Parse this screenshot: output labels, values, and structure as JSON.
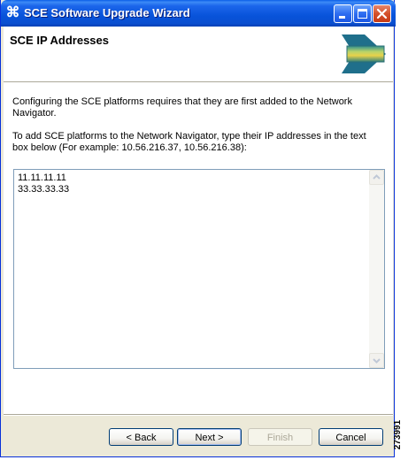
{
  "window": {
    "title": "SCE Software Upgrade Wizard",
    "app_icon": "cisco-bridge-icon"
  },
  "header": {
    "title": "SCE IP Addresses",
    "logo_icon": "wizard-banner-icon"
  },
  "content": {
    "paragraph1": "Configuring the SCE platforms requires that they are first added to the Network Navigator.",
    "paragraph2": "To add SCE platforms to the Network Navigator, type their IP addresses in the text box below (For example: 10.56.216.37, 10.56.216.38):",
    "ip_lines": [
      "11.11.11.11",
      "33.33.33.33"
    ]
  },
  "buttons": {
    "back": "< Back",
    "next": "Next >",
    "finish": "Finish",
    "cancel": "Cancel"
  },
  "figure_code": "273991",
  "colors": {
    "titlebar": "#0853DA",
    "dialog_bg": "#ECE9D8",
    "close_button": "#D4502A"
  }
}
